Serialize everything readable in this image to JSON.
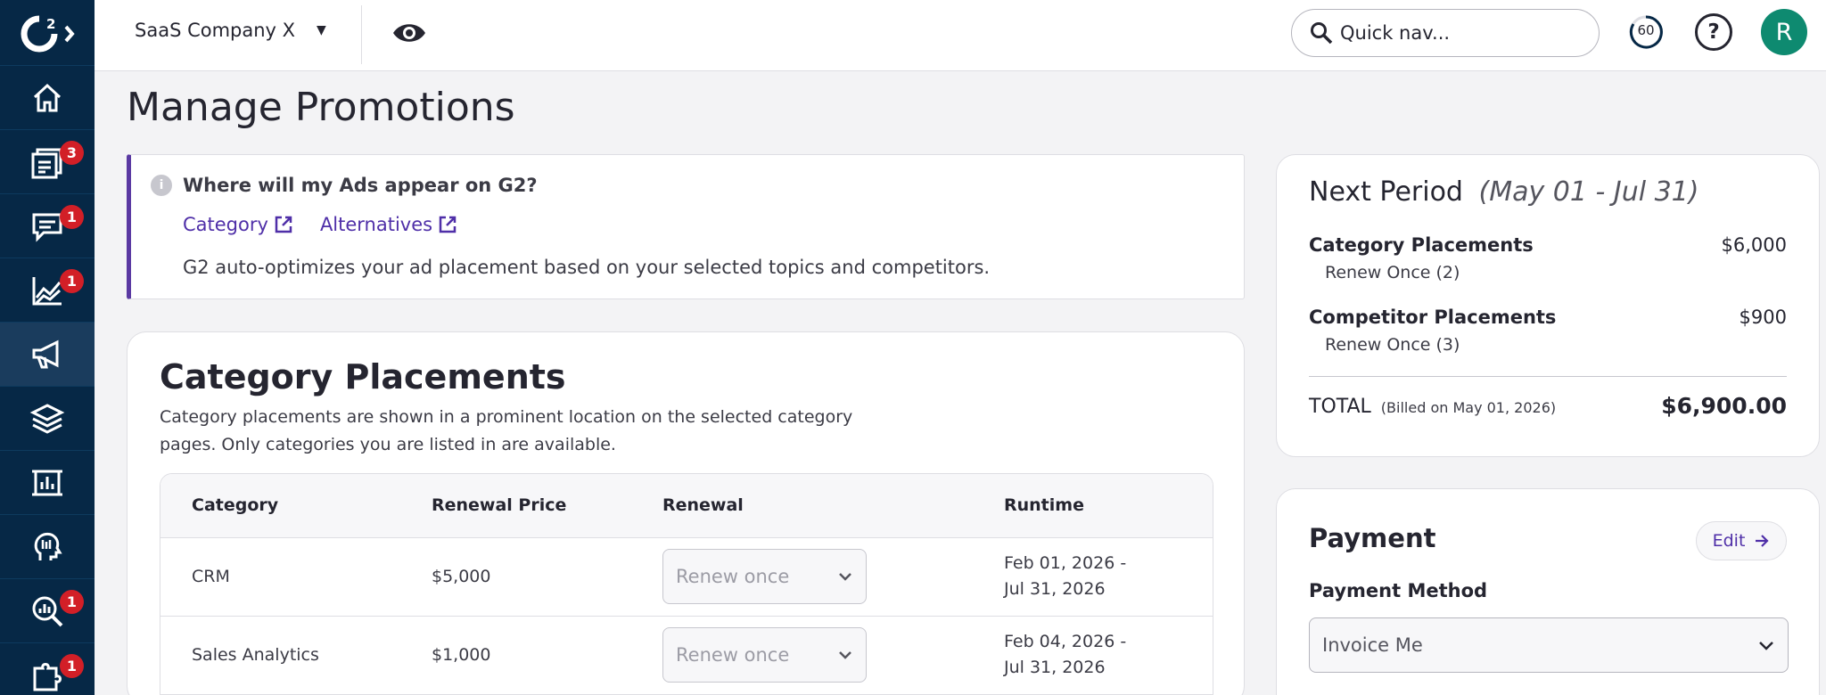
{
  "topbar": {
    "company": "SaaS Company X",
    "search_placeholder": "Quick nav...",
    "timer": "60",
    "avatar_initial": "R"
  },
  "sidebar": {
    "items": [
      {
        "icon": "home-icon",
        "badge": ""
      },
      {
        "icon": "reviews-icon",
        "badge": "3"
      },
      {
        "icon": "chat-icon",
        "badge": "1"
      },
      {
        "icon": "chart-icon",
        "badge": "1"
      },
      {
        "icon": "megaphone-icon",
        "badge": "",
        "active": true
      },
      {
        "icon": "layers-icon",
        "badge": ""
      },
      {
        "icon": "report-icon",
        "badge": ""
      },
      {
        "icon": "head-icon",
        "badge": ""
      },
      {
        "icon": "search-analytics-icon",
        "badge": "1"
      },
      {
        "icon": "puzzle-icon",
        "badge": "1"
      }
    ]
  },
  "page": {
    "title": "Manage Promotions"
  },
  "info": {
    "question": "Where will my Ads appear on G2?",
    "link_category": "Category",
    "link_alternatives": "Alternatives",
    "description": "G2 auto-optimizes your ad placement based on your selected topics and competitors."
  },
  "category_card": {
    "title": "Category Placements",
    "description": "Category placements are shown in a prominent location on the selected category pages. Only categories you are listed in are available.",
    "headers": [
      "Category",
      "Renewal Price",
      "Renewal",
      "Runtime"
    ],
    "rows": [
      {
        "category": "CRM",
        "price": "$5,000",
        "renewal": "Renew once",
        "runtime_start": "Feb 01, 2026 -",
        "runtime_end": "Jul 31, 2026"
      },
      {
        "category": "Sales Analytics",
        "price": "$1,000",
        "renewal": "Renew once",
        "runtime_start": "Feb 04, 2026 -",
        "runtime_end": "Jul 31, 2026"
      }
    ]
  },
  "summary": {
    "title": "Next Period",
    "period": "(May 01 - Jul 31)",
    "category_label": "Category Placements",
    "category_amount": "$6,000",
    "category_sub": "Renew Once (2)",
    "competitor_label": "Competitor Placements",
    "competitor_amount": "$900",
    "competitor_sub": "Renew Once (3)",
    "total_label": "TOTAL",
    "total_note": "(Billed on May 01, 2026)",
    "total_amount": "$6,900.00"
  },
  "payment": {
    "title": "Payment",
    "edit_label": "Edit",
    "method_label": "Payment Method",
    "method_value": "Invoice Me"
  }
}
